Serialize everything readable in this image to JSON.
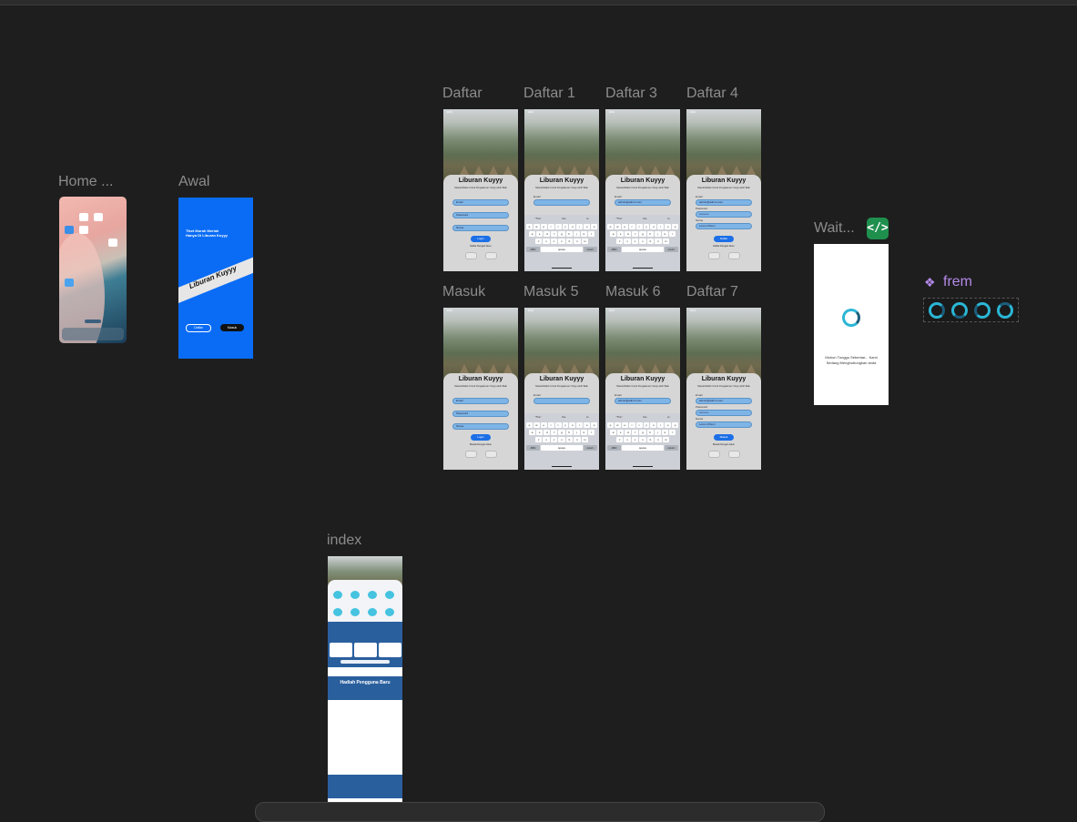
{
  "canvas": {
    "bg_color": "#1e1e1e"
  },
  "frames": {
    "home": {
      "label": "Home ..."
    },
    "awal": {
      "label": "Awal",
      "tagline": "Tiket Murah Meriah Hanya Di Liburan Kuyyy",
      "brand": "Liburan Kuyyy",
      "btn_daftar": "Daftar",
      "btn_masuk": "Masuk",
      "bg_color": "#0a6cf5"
    },
    "daftar": {
      "label": "Daftar"
    },
    "daftar1": {
      "label": "Daftar 1"
    },
    "daftar3": {
      "label": "Daftar 3"
    },
    "daftar4": {
      "label": "Daftar 4"
    },
    "masuk": {
      "label": "Masuk"
    },
    "masuk5": {
      "label": "Masuk 5"
    },
    "masuk6": {
      "label": "Masuk 6"
    },
    "daftar7": {
      "label": "Daftar 7"
    },
    "wait": {
      "label": "Wait...",
      "message": "Mohon Tunggu Sebentar... Kami Sedang Menghubungkan anda"
    },
    "frem": {
      "label": "frem"
    },
    "index": {
      "label": "index",
      "promo_title": "Hadiah Pengguna Baru",
      "accent": "#2a5f9e"
    }
  },
  "auth": {
    "title": "Liburan Kuyyy",
    "subtitle": "Masuk/Daftar Untuk Pengalaman Yang Lebih Baik",
    "email_placeholder": "Email",
    "password_placeholder": "Password",
    "name_placeholder": "Nama",
    "login": "Login",
    "daftar": "Daftar",
    "alt_daftar": "Daftar Dengan Akun",
    "alt_masuk": "Masuk Dengan Akun",
    "email_value": "admin@admin.com",
    "name_value": "Lorem iPsum",
    "password_value": "••••••••••",
    "kb_row1": "q w e r t y u i o p",
    "kb_row2": "a s d f g h j k l",
    "kb_row3": "z x c v b n m",
    "kb_abc": "ABC",
    "kb_space": "space",
    "kb_return": "return",
    "kb_sugg": [
      "\"The\"",
      "the",
      "to"
    ]
  },
  "wait_icon": "code-brackets-icon",
  "frem_icon": "component-icon",
  "colors": {
    "field": "#7fb5e6",
    "button": "#1c6fe6",
    "component": "#b48ae9",
    "loader": "#2bb6d6"
  }
}
